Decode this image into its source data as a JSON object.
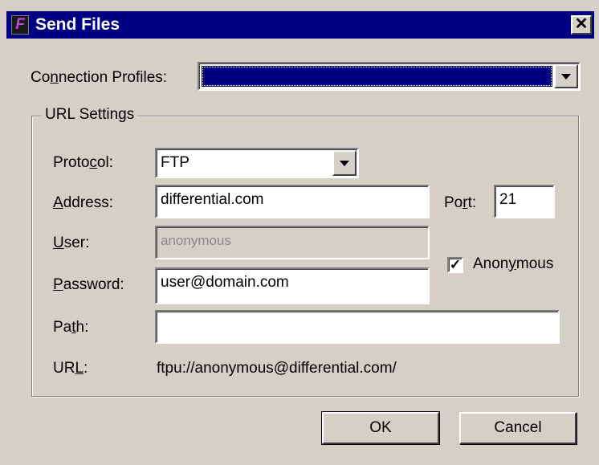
{
  "window": {
    "title": "Send Files",
    "icon": "app-f-icon",
    "close_glyph": "✕"
  },
  "connection_profiles": {
    "label_pre": "Co",
    "label_accel": "n",
    "label_post": "nection Profiles:",
    "value": ""
  },
  "url_settings": {
    "title": "URL Settings",
    "protocol": {
      "label_pre": "Proto",
      "label_accel": "c",
      "label_post": "ol:",
      "value": "FTP"
    },
    "address": {
      "label_pre": "",
      "label_accel": "A",
      "label_post": "ddress:",
      "value": "differential.com"
    },
    "port": {
      "label_pre": "Po",
      "label_accel": "r",
      "label_post": "t:",
      "value": "21"
    },
    "user": {
      "label_pre": "",
      "label_accel": "U",
      "label_post": "ser:",
      "value": "anonymous"
    },
    "anonymous": {
      "label_pre": "Anon",
      "label_accel": "y",
      "label_post": "mous",
      "checked": true,
      "check_glyph": "✓"
    },
    "password": {
      "label_pre": "",
      "label_accel": "P",
      "label_post": "assword:",
      "value": "user@domain.com"
    },
    "path": {
      "label_pre": "Pa",
      "label_accel": "t",
      "label_post": "h:",
      "value": ""
    },
    "url": {
      "label_pre": "UR",
      "label_accel": "L",
      "label_post": ":",
      "value": "ftpu://anonymous@differential.com/"
    }
  },
  "buttons": {
    "ok": "OK",
    "cancel": "Cancel"
  },
  "colors": {
    "titlebar": "#000080",
    "face": "#d4d0c8",
    "selection": "#000080"
  }
}
